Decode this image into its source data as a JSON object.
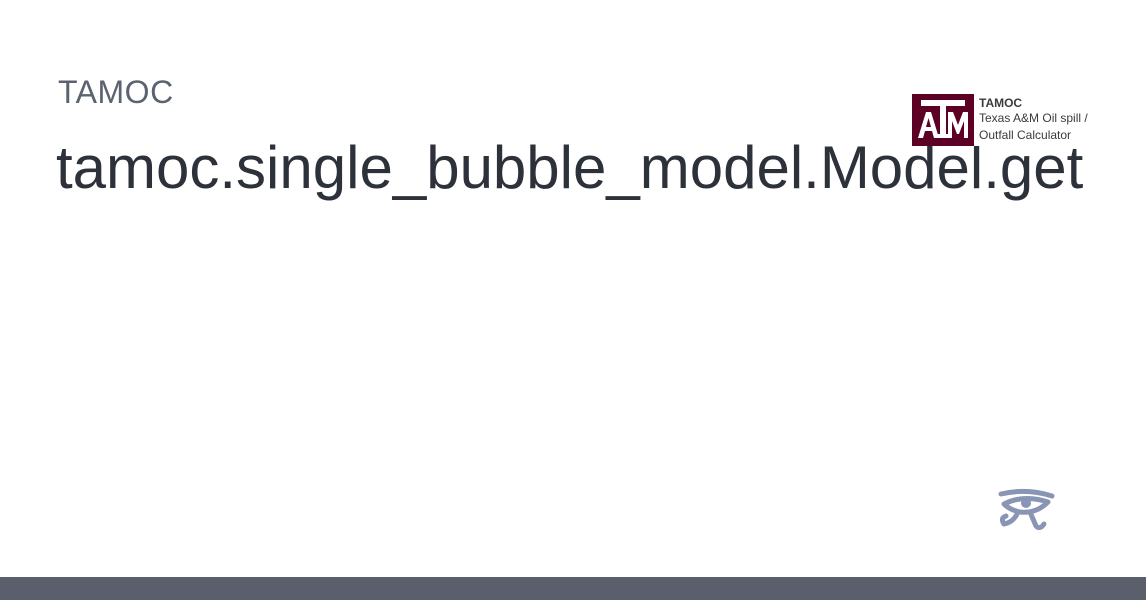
{
  "site": {
    "name": "TAMOC"
  },
  "page": {
    "title": "tamoc.single_bubble_model.Model.get"
  },
  "logo": {
    "mark_text": "ATM",
    "title": "TAMOC",
    "subtitle_line1": "Texas A&M Oil spill /",
    "subtitle_line2": "Outfall Calculator"
  },
  "icons": {
    "footer": "eye-of-horus-icon"
  },
  "colors": {
    "title": "#2c313a",
    "site_name": "#5b6270",
    "logo_maroon": "#5c0025",
    "footer_bar": "#5a5f6b",
    "eye_icon": "#8a95b5"
  }
}
